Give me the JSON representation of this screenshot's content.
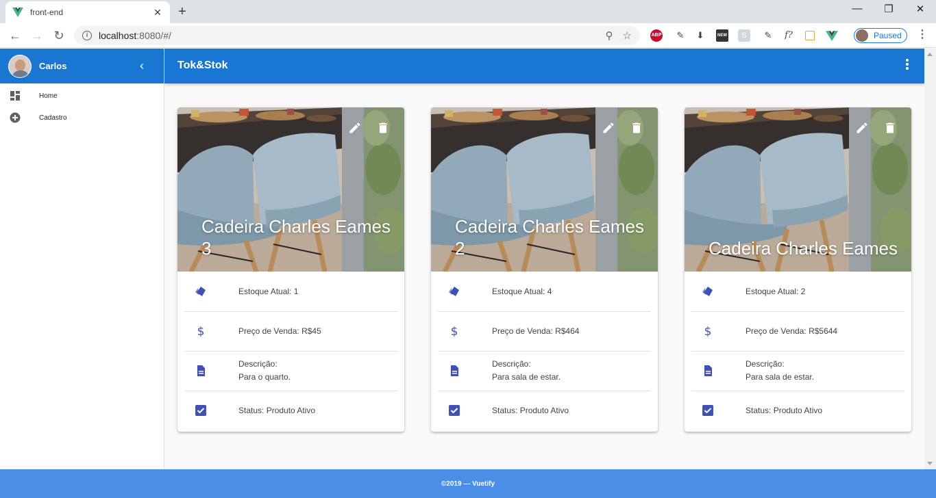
{
  "browser": {
    "tab_title": "front-end",
    "url_host": "localhost",
    "url_rest": ":8080/#/",
    "profile_status": "Paused",
    "extensions": {
      "abp": "ABP",
      "new_badge": "NEW",
      "s_badge": "S",
      "fx": "f?"
    }
  },
  "sidebar": {
    "user_name": "Carlos",
    "items": [
      {
        "label": "Home",
        "icon": "dashboard-icon"
      },
      {
        "label": "Cadastro",
        "icon": "add-circle-icon"
      }
    ]
  },
  "appbar": {
    "title": "Tok&Stok"
  },
  "products": [
    {
      "title": "Cadeira Charles Eames 3",
      "stock": "Estoque Atual: 1",
      "price": "Preço de Venda: R$45",
      "desc_label": "Descrição:",
      "desc": "Para o quarto.",
      "status": "Status: Produto Ativo"
    },
    {
      "title": "Cadeira Charles Eames 2",
      "stock": "Estoque Atual: 4",
      "price": "Preço de Venda: R$464",
      "desc_label": "Descrição:",
      "desc": "Para sala de estar.",
      "status": "Status: Produto Ativo"
    },
    {
      "title": "Cadeira Charles Eames",
      "stock": "Estoque Atual: 2",
      "price": "Preço de Venda: R$5644",
      "desc_label": "Descrição:",
      "desc": "Para sala de estar.",
      "status": "Status: Produto Ativo"
    }
  ],
  "footer": {
    "text": "©2019 — Vuetify"
  },
  "colors": {
    "primary": "#1976d2",
    "footer": "#4a8ee8",
    "icon": "#3f51b5"
  }
}
